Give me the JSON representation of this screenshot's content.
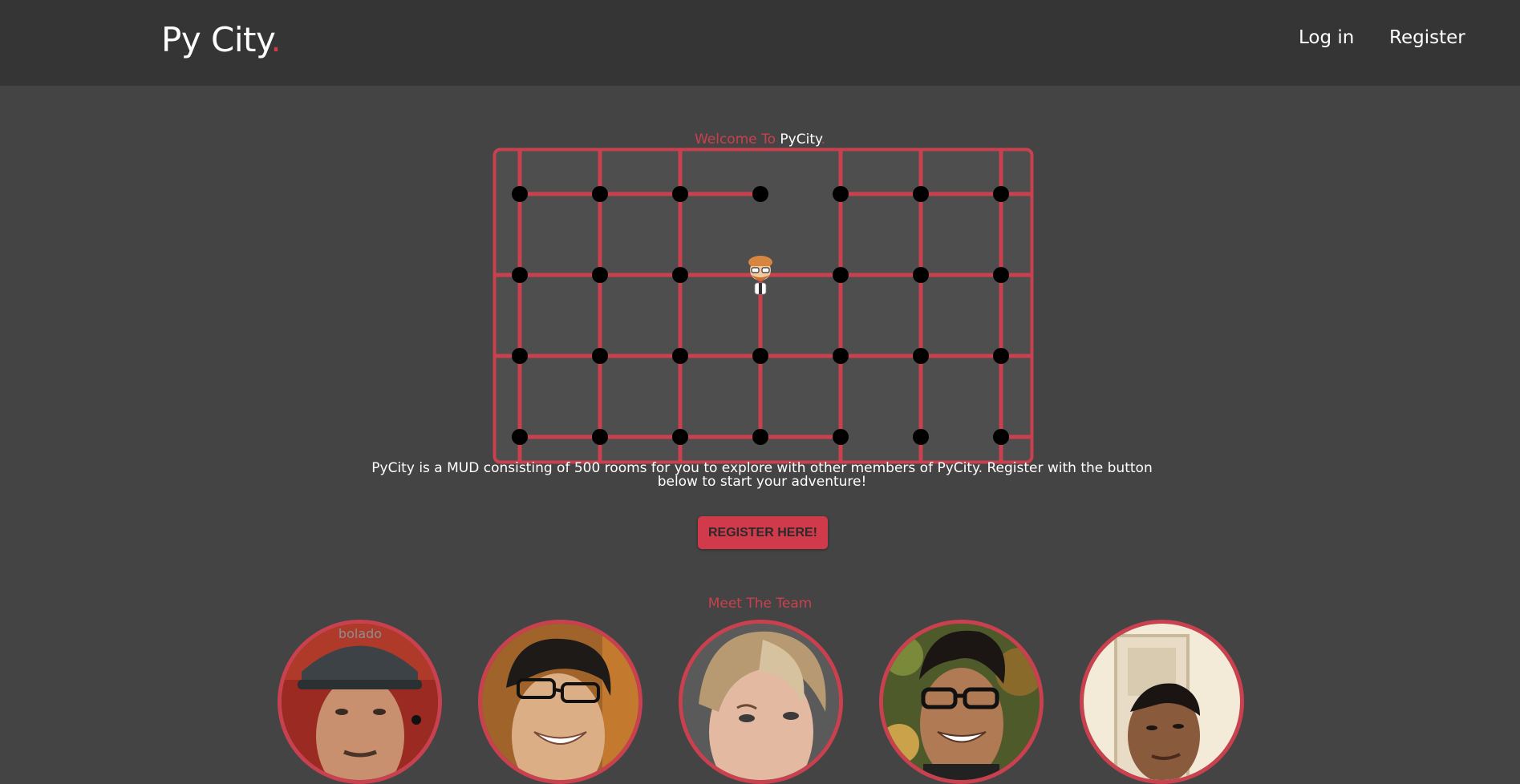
{
  "header": {
    "brand": "Py City",
    "brand_dot": ".",
    "nav": {
      "login": "Log in",
      "register": "Register"
    }
  },
  "hero": {
    "welcome_prefix": "Welcome To ",
    "welcome_name": "PyCity",
    "welcome_dot": ".",
    "description": "PyCity is a MUD consisting of 500 rooms for you to explore with other members of PyCity. Register with the button below to start your adventure!",
    "cta_label": "REGISTER HERE!"
  },
  "map": {
    "columns": 7,
    "rows": 4,
    "player_position": {
      "col": 3,
      "row": 1
    },
    "colors": {
      "frame": "#c9404e",
      "room": "#000000",
      "background": "#4e4e4e"
    }
  },
  "team": {
    "heading": "Meet The Team",
    "members": [
      {
        "avatar_icon": "team-member-photo"
      },
      {
        "avatar_icon": "team-member-photo"
      },
      {
        "avatar_icon": "team-member-photo"
      },
      {
        "avatar_icon": "team-member-photo"
      },
      {
        "avatar_icon": "team-member-photo"
      }
    ]
  },
  "colors": {
    "accent": "#d03a4a",
    "nav_bg": "#353535",
    "page_bg": "#444444"
  }
}
